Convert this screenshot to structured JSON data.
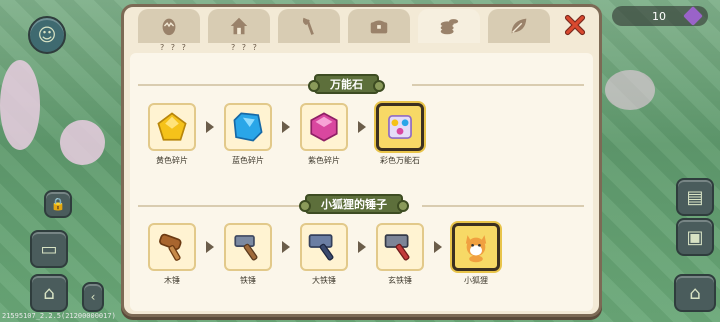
{
  "hud": {
    "build_version": "21595107_2.2.5(21200000017)",
    "coins_value": "10"
  },
  "tabs": [
    {
      "icon": "egg-icon",
      "caption": "? ? ?"
    },
    {
      "icon": "house-icon",
      "caption": "? ? ?"
    },
    {
      "icon": "axe-icon",
      "caption": ""
    },
    {
      "icon": "chest-icon",
      "caption": ""
    },
    {
      "icon": "coins-icon",
      "caption": "",
      "active": true
    },
    {
      "icon": "leaf-icon",
      "caption": ""
    }
  ],
  "sections": [
    {
      "title": "万能石",
      "items": [
        {
          "label": "黄色碎片",
          "color": "#f5c21a"
        },
        {
          "label": "蓝色碎片",
          "color": "#2aa6e8"
        },
        {
          "label": "紫色碎片",
          "color": "#d9479f"
        },
        {
          "label": "彩色万能石",
          "color": "#c8a0f0"
        }
      ]
    },
    {
      "title": "小狐狸的锤子",
      "items": [
        {
          "label": "木锤",
          "color": "#a8652e"
        },
        {
          "label": "铁锤",
          "color": "#7c8aa2"
        },
        {
          "label": "大铁锤",
          "color": "#6b7ea3"
        },
        {
          "label": "玄铁锤",
          "color": "#7d8597"
        },
        {
          "label": "小狐狸",
          "color": "#f0a040"
        }
      ]
    }
  ],
  "colors": {
    "panel_bg": "#f3ead6",
    "panel_border": "#7c6a55",
    "section_title_bg": "#5d6f3b",
    "close_x": "#c33a2a"
  }
}
